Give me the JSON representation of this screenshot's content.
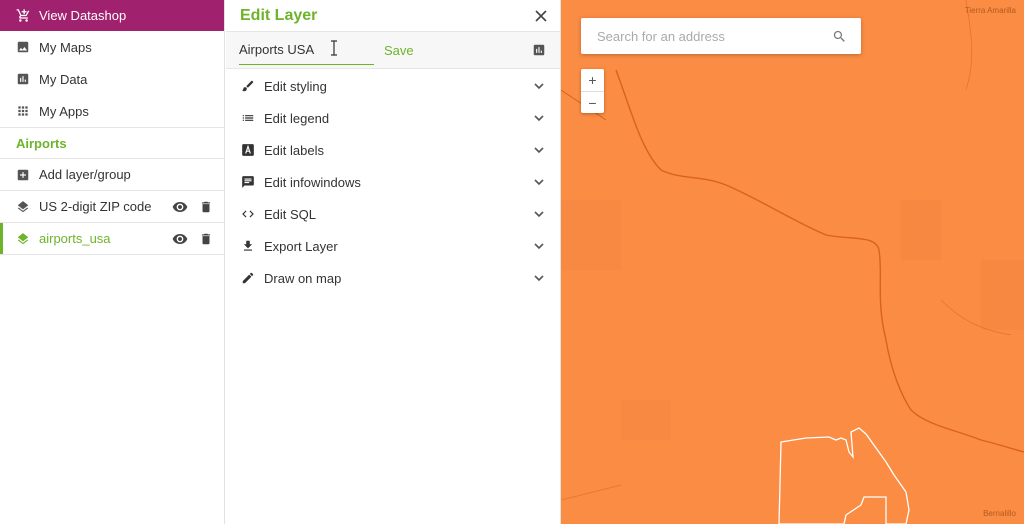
{
  "sidebar": {
    "top_label": "View Datashop",
    "items": [
      {
        "label": "My Maps"
      },
      {
        "label": "My Data"
      },
      {
        "label": "My Apps"
      }
    ],
    "section_title": "Airports",
    "add_label": "Add layer/group",
    "layers": [
      {
        "label": "US 2-digit ZIP code",
        "active": false
      },
      {
        "label": "airports_usa",
        "active": true
      }
    ],
    "colors": {
      "accent": "#6eb42b",
      "brand": "#a0226e"
    }
  },
  "panel": {
    "title": "Edit Layer",
    "layer_name_value": "Airports USA",
    "save_label": "Save",
    "sections": [
      {
        "label": "Edit styling",
        "icon": "brush-icon"
      },
      {
        "label": "Edit legend",
        "icon": "list-icon"
      },
      {
        "label": "Edit labels",
        "icon": "text-icon"
      },
      {
        "label": "Edit infowindows",
        "icon": "comment-icon"
      },
      {
        "label": "Edit SQL",
        "icon": "code-icon"
      },
      {
        "label": "Export Layer",
        "icon": "download-icon"
      },
      {
        "label": "Draw on map",
        "icon": "pencil-icon"
      }
    ]
  },
  "map": {
    "search_placeholder": "Search for an address",
    "zoom_in": "+",
    "zoom_out": "−",
    "labels": {
      "top_right": "Tierra Amarilla",
      "bottom_right": "Bernalillo"
    },
    "fill_color": "#fb8c44"
  }
}
